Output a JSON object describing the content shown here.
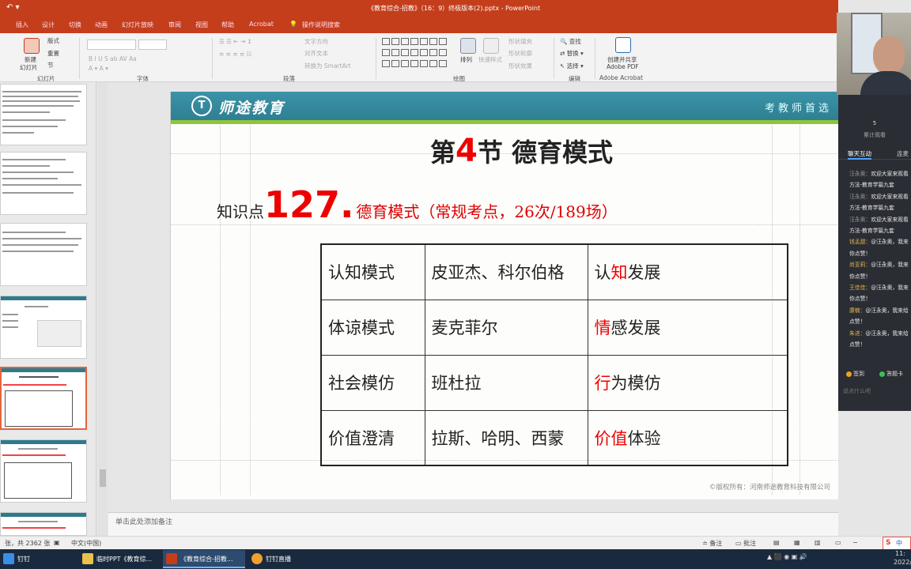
{
  "window": {
    "title": "《教育综合-招教》（16：9）终极版本(2).pptx - PowerPoint"
  },
  "ribbon_tabs": [
    {
      "label": "插入"
    },
    {
      "label": "设计"
    },
    {
      "label": "切换"
    },
    {
      "label": "动画"
    },
    {
      "label": "幻灯片放映"
    },
    {
      "label": "审阅"
    },
    {
      "label": "视图"
    },
    {
      "label": "帮助"
    },
    {
      "label": "Acrobat"
    },
    {
      "label": "操作说明搜索"
    }
  ],
  "ribbon": {
    "slides_group": {
      "layout": "版式",
      "reset": "重置",
      "section": "节",
      "new_slide": "新建",
      "new_slide2": "幻灯片",
      "group_label": "幻灯片"
    },
    "font_group_label": "字体",
    "paragraph_group": {
      "text_direction": "文字方向",
      "align_text": "对齐文本",
      "smartart": "转换为 SmartArt",
      "group_label": "段落"
    },
    "drawing_group": {
      "arrange": "排列",
      "quick_styles": "快速样式",
      "shape_fill": "形状填充",
      "shape_outline": "形状轮廓",
      "shape_effects": "形状效果",
      "group_label": "绘图"
    },
    "editing_group": {
      "find": "查找",
      "replace": "替换",
      "select": "选择",
      "group_label": "编辑"
    },
    "adobe_group": {
      "create_share": "创建并共享",
      "adobe_pdf": "Adobe PDF",
      "group_label": "Adobe Acrobat"
    }
  },
  "slide": {
    "brand": "师途教育",
    "tagline": "考教师首选",
    "section_prefix": "第",
    "section_num": "4",
    "section_suffix": "节  德育模式",
    "kp_label": "知识点",
    "kp_number": "127.",
    "kp_title": "德育模式",
    "kp_note": "（常规考点，26次/189场）",
    "rows": [
      {
        "mode": "认知模式",
        "person": "皮亚杰、科尔伯格",
        "focus_pre": "认",
        "focus_red": "知",
        "focus_post": "发展"
      },
      {
        "mode": "体谅模式",
        "person": "麦克菲尔",
        "focus_pre": "",
        "focus_red": "情",
        "focus_post": "感发展"
      },
      {
        "mode": "社会模仿",
        "person": "班杜拉",
        "focus_pre": "",
        "focus_red": "行",
        "focus_post": "为模仿"
      },
      {
        "mode": "价值澄清",
        "person": "拉斯、哈明、西蒙",
        "focus_pre": "",
        "focus_red": "价值",
        "focus_post": "体验"
      }
    ],
    "copyright": "©版权所有：河南师途教育科技有限公司"
  },
  "notes_placeholder": "单击此处添加备注",
  "statusbar": {
    "slide_count": "张，共 2362 张",
    "language": "中文(中国)",
    "notes": "备注",
    "comments": "批注"
  },
  "taskbar": {
    "items": [
      {
        "label": "钉钉"
      },
      {
        "label": "临时PPT《教育综..."
      },
      {
        "label": "《教育综合-招教..."
      },
      {
        "label": "钉钉直播"
      }
    ],
    "time": "11:",
    "date": "2022/"
  },
  "chat": {
    "viewer_count": "5",
    "viewer_label": "累计观看",
    "tab_chat": "聊天互动",
    "tab_other": "连麦",
    "messages": [
      {
        "name": "汪永奥：",
        "text": "欢迎大家来观看",
        "name_color": "gray"
      },
      {
        "name": "",
        "text": "方法-教育学篇九套",
        "name_color": "gray"
      },
      {
        "name": "汪永奥：",
        "text": "欢迎大家来观看",
        "name_color": "gray"
      },
      {
        "name": "",
        "text": "方法-教育学篇九套",
        "name_color": "gray"
      },
      {
        "name": "汪永奥：",
        "text": "欢迎大家来观看",
        "name_color": "gray"
      },
      {
        "name": "",
        "text": "方法-教育学篇九套",
        "name_color": "gray"
      },
      {
        "name": "钱孟甜：",
        "text": "@汪永奥，我来",
        "name_color": "gold"
      },
      {
        "name": "",
        "text": "你点赞！",
        "name_color": "gold"
      },
      {
        "name": "尚亚莉：",
        "text": "@汪永奥，我来",
        "name_color": "gold"
      },
      {
        "name": "",
        "text": "你点赞！",
        "name_color": "gold"
      },
      {
        "name": "王佳佳：",
        "text": "@汪永奥，我来",
        "name_color": "gold"
      },
      {
        "name": "",
        "text": "你点赞！",
        "name_color": "gold"
      },
      {
        "name": "康楠：",
        "text": "@汪永奥，我来给",
        "name_color": "gold"
      },
      {
        "name": "",
        "text": "点赞！",
        "name_color": "gold"
      },
      {
        "name": "朱进：",
        "text": "@汪永奥，我来给",
        "name_color": "gold"
      },
      {
        "name": "",
        "text": "点赞！",
        "name_color": "gold"
      }
    ],
    "sign_in": "签到",
    "answer_card": "答题卡",
    "input_placeholder": "说点什么吧"
  },
  "colors": {
    "ribbon_red": "#c43e1c",
    "slide_header_teal": "#2f7f92",
    "slide_accent_green": "#8fc43c",
    "emphasis_red": "#e00000"
  }
}
